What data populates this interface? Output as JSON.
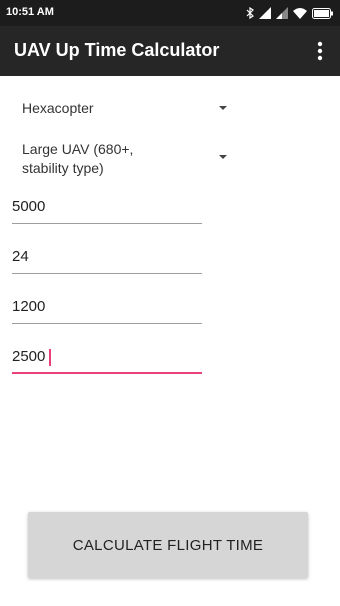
{
  "status_bar": {
    "time": "10:51 AM",
    "icons": [
      "bluetooth-icon",
      "signal-icon",
      "signal-icon",
      "wifi-icon",
      "battery-icon"
    ]
  },
  "app_bar": {
    "title": "UAV Up Time Calculator",
    "menu_icon": "more-vert-icon"
  },
  "spinners": [
    {
      "value": "Hexacopter"
    },
    {
      "value": "Large UAV (680+, stability type)"
    }
  ],
  "fields": [
    {
      "value": "5000"
    },
    {
      "value": "24"
    },
    {
      "value": "1200"
    },
    {
      "value": "2500",
      "focused": true
    }
  ],
  "button": {
    "label": "CALCULATE FLIGHT TIME"
  },
  "colors": {
    "status_bar": "#1c1c1c",
    "app_bar": "#262626",
    "focus_accent": "#ec407a",
    "button": "#d6d6d6"
  }
}
